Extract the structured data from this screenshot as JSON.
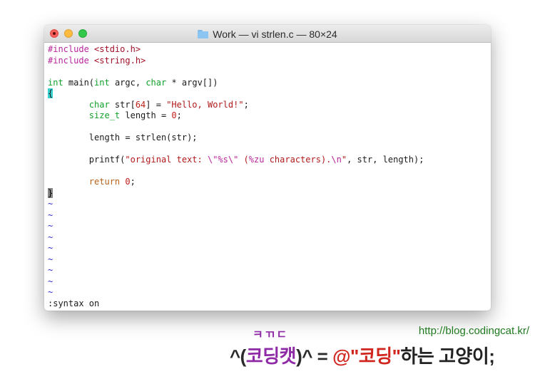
{
  "window": {
    "title": "Work — vi strlen.c — 80×24"
  },
  "editor": {
    "lines": [
      [
        {
          "t": "#include",
          "c": "pp"
        },
        {
          "t": " "
        },
        {
          "t": "<stdio.h>",
          "c": "hdr"
        }
      ],
      [
        {
          "t": "#include",
          "c": "pp"
        },
        {
          "t": " "
        },
        {
          "t": "<string.h>",
          "c": "hdr"
        }
      ],
      [],
      [
        {
          "t": "int",
          "c": "ty"
        },
        {
          "t": " main("
        },
        {
          "t": "int",
          "c": "ty"
        },
        {
          "t": " argc, "
        },
        {
          "t": "char",
          "c": "ty"
        },
        {
          "t": " * argv[])"
        }
      ],
      [
        {
          "t": "{",
          "c": "brace-hl"
        }
      ],
      [
        {
          "t": "        "
        },
        {
          "t": "char",
          "c": "ty"
        },
        {
          "t": " str["
        },
        {
          "t": "64",
          "c": "num"
        },
        {
          "t": "] = "
        },
        {
          "t": "\"Hello, World!\"",
          "c": "str"
        },
        {
          "t": ";"
        }
      ],
      [
        {
          "t": "        "
        },
        {
          "t": "size_t",
          "c": "ty"
        },
        {
          "t": " length = "
        },
        {
          "t": "0",
          "c": "num"
        },
        {
          "t": ";"
        }
      ],
      [],
      [
        {
          "t": "        length = strlen(str);"
        }
      ],
      [],
      [
        {
          "t": "        printf("
        },
        {
          "t": "\"original text: ",
          "c": "str"
        },
        {
          "t": "\\\"",
          "c": "pp"
        },
        {
          "t": "%s",
          "c": "pp"
        },
        {
          "t": "\\\"",
          "c": "pp"
        },
        {
          "t": " (",
          "c": "str"
        },
        {
          "t": "%zu",
          "c": "pp"
        },
        {
          "t": " characters).",
          "c": "str"
        },
        {
          "t": "\\n",
          "c": "pp"
        },
        {
          "t": "\"",
          "c": "str"
        },
        {
          "t": ", str, length);"
        }
      ],
      [],
      [
        {
          "t": "        "
        },
        {
          "t": "return",
          "c": "kw"
        },
        {
          "t": " "
        },
        {
          "t": "0",
          "c": "num"
        },
        {
          "t": ";"
        }
      ],
      [
        {
          "t": "}",
          "c": "cursor"
        }
      ],
      [
        {
          "t": "~",
          "c": "tilde"
        }
      ],
      [
        {
          "t": "~",
          "c": "tilde"
        }
      ],
      [
        {
          "t": "~",
          "c": "tilde"
        }
      ],
      [
        {
          "t": "~",
          "c": "tilde"
        }
      ],
      [
        {
          "t": "~",
          "c": "tilde"
        }
      ],
      [
        {
          "t": "~",
          "c": "tilde"
        }
      ],
      [
        {
          "t": "~",
          "c": "tilde"
        }
      ],
      [
        {
          "t": "~",
          "c": "tilde"
        }
      ],
      [
        {
          "t": "~",
          "c": "tilde"
        }
      ],
      [
        {
          "t": ":syntax on"
        }
      ]
    ]
  },
  "watermark": {
    "url": "http://blog.codingcat.kr/",
    "small": "ㅋㄲㄷ",
    "main_a": "^(",
    "main_b": "코딩캣",
    "main_c": ")^ = ",
    "main_d": "@\"코딩\"",
    "main_e": "하는 고양이;"
  }
}
